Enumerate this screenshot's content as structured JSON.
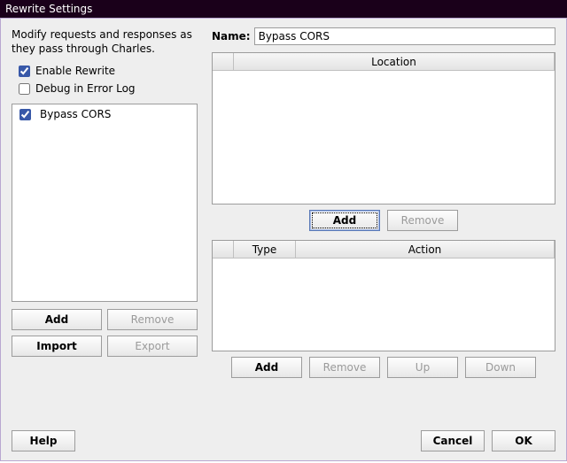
{
  "title": "Rewrite Settings",
  "left": {
    "description": "Modify requests and responses as they pass through Charles.",
    "enable_rewrite": {
      "label": "Enable Rewrite",
      "checked": true
    },
    "debug_error_log": {
      "label": "Debug in Error Log",
      "checked": false
    },
    "sets": [
      {
        "label": "Bypass CORS",
        "checked": true
      }
    ],
    "buttons": {
      "add": "Add",
      "remove": "Remove",
      "import": "Import",
      "export": "Export"
    }
  },
  "right": {
    "name_label": "Name:",
    "name_value": "Bypass CORS",
    "location_header": "Location",
    "location_buttons": {
      "add": "Add",
      "remove": "Remove"
    },
    "rules_headers": {
      "type": "Type",
      "action": "Action"
    },
    "rules_buttons": {
      "add": "Add",
      "remove": "Remove",
      "up": "Up",
      "down": "Down"
    }
  },
  "bottom": {
    "help": "Help",
    "cancel": "Cancel",
    "ok": "OK"
  }
}
